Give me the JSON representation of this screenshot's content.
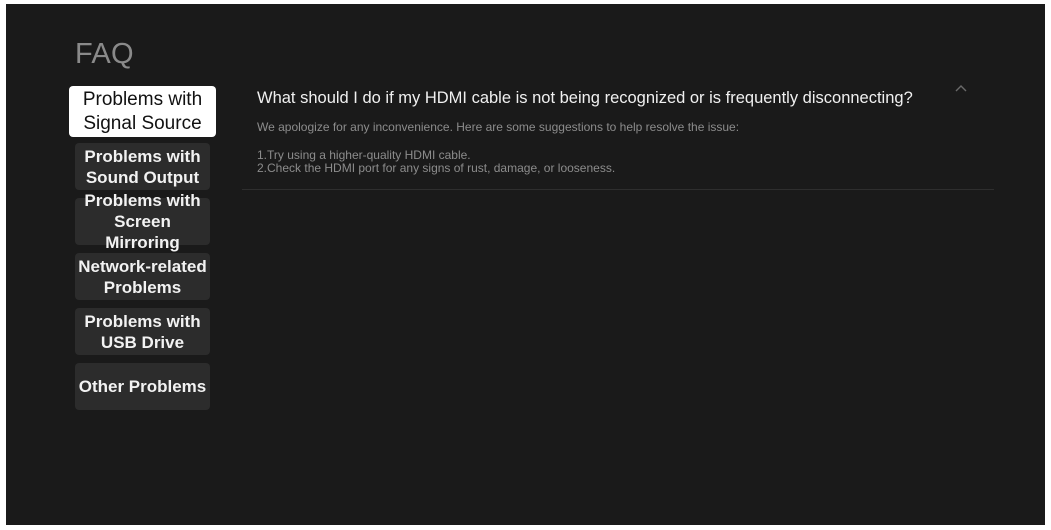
{
  "page": {
    "title": "FAQ"
  },
  "sidebar": {
    "items": [
      {
        "label": "Problems with\nSignal Source",
        "active": true
      },
      {
        "label": "Problems with\nSound Output",
        "active": false
      },
      {
        "label": "Problems with\nScreen Mirroring",
        "active": false
      },
      {
        "label": "Network-related\nProblems",
        "active": false
      },
      {
        "label": "Problems with\nUSB Drive",
        "active": false
      },
      {
        "label": "Other Problems",
        "active": false
      }
    ]
  },
  "faq": {
    "items": [
      {
        "question": "What should I do if my HDMI cable is not being recognized or is frequently disconnecting?",
        "expanded": true,
        "answer_intro": "We apologize for any inconvenience. Here are some suggestions to help resolve the issue:",
        "steps": [
          "1.Try using a higher-quality HDMI cable.",
          "2.Check the HDMI port for any signs of rust, damage, or looseness."
        ],
        "toggle_icon": "chevron-up-icon"
      }
    ]
  },
  "colors": {
    "background": "#1a1a1a",
    "nav_item": "#2c2c2c",
    "nav_item_active": "#ffffff",
    "text_primary": "#f0f0f0",
    "text_secondary": "#8c8c8c"
  }
}
